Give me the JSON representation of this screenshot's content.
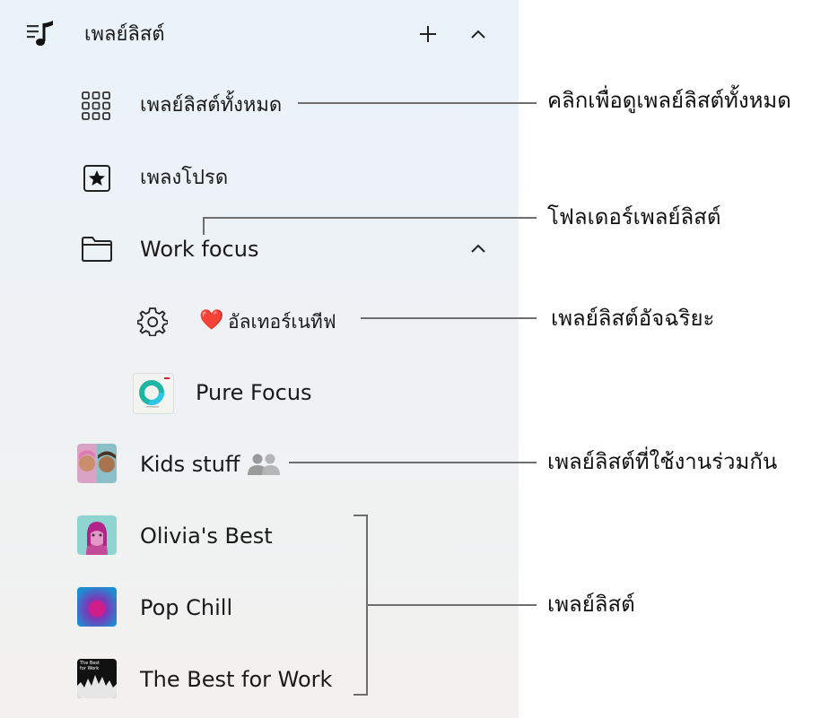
{
  "header": {
    "title": "เพลย์ลิสต์"
  },
  "nav": {
    "all_playlists": "เพลย์ลิสต์ทั้งหมด",
    "favorites": "เพลงโปรด"
  },
  "folder": {
    "label": "Work focus"
  },
  "smart_playlist": {
    "emoji": "❤️",
    "label": "อัลเทอร์เนทีฟ"
  },
  "pure_focus": {
    "label": "Pure Focus"
  },
  "shared": {
    "label": "Kids stuff"
  },
  "playlists": [
    {
      "label": "Olivia's Best"
    },
    {
      "label": "Pop Chill"
    },
    {
      "label": "The Best for Work",
      "art_text": "The Best for Work"
    }
  ],
  "callouts": {
    "all_playlists": "คลิกเพื่อดูเพลย์ลิสต์ทั้งหมด",
    "folder": "โฟลเดอร์เพลย์ลิสต์",
    "smart": "เพลย์ลิสต์อัจฉริยะ",
    "shared": "เพลย์ลิสต์ที่ใช้งานร่วมกัน",
    "playlists": "เพลย์ลิสต์"
  },
  "icons": {
    "header": "playlist-music-icon",
    "add": "plus-icon",
    "collapse": "chevron-up-icon",
    "all": "grid-icon",
    "favorites": "star-square-icon",
    "folder": "folder-icon",
    "smart": "gear-icon",
    "shared": "people-icon"
  },
  "colors": {
    "accent_pink": "#e8165a",
    "line": "#6e6e6e"
  }
}
